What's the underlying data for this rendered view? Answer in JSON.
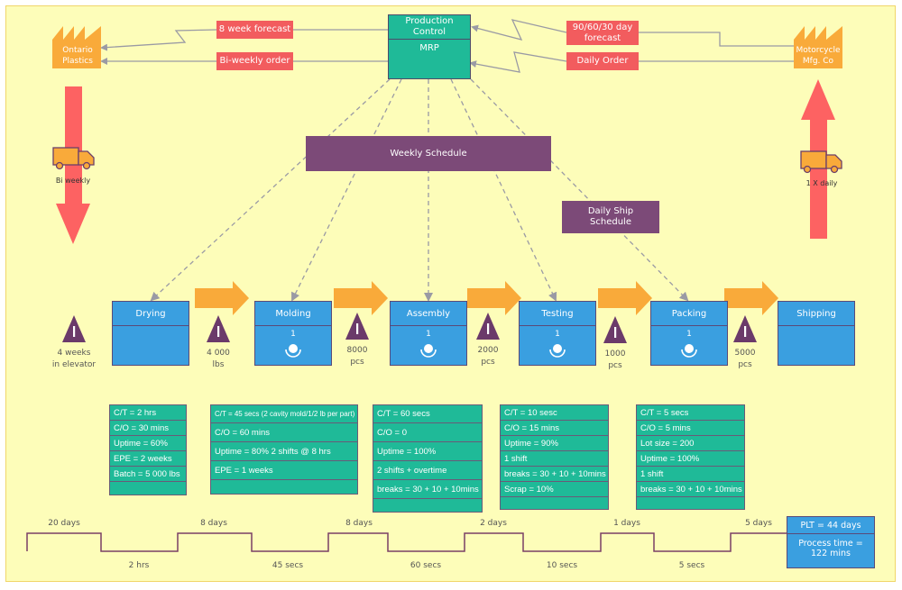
{
  "suppliers": {
    "supplier": {
      "label_line1": "Ontario",
      "label_line2": "Plastics"
    },
    "customer": {
      "label_line1": "Motorcycle",
      "label_line2": "Mfg. Co"
    }
  },
  "control": {
    "title": "Production Control",
    "subtitle": "MRP"
  },
  "info_flows": {
    "forecast_to_supplier": "8 week forecast",
    "order_to_supplier": "Bi-weekly order",
    "forecast_from_customer_line1": "90/60/30 day",
    "forecast_from_customer_line2": "forecast",
    "order_from_customer": "Daily Order"
  },
  "schedules": {
    "weekly": "Weekly Schedule",
    "daily_ship_line1": "Daily Ship",
    "daily_ship_line2": "Schedule"
  },
  "shipments": {
    "inbound": "Bi weekly",
    "outbound": "1 X daily"
  },
  "processes": [
    {
      "name": "Drying",
      "operators": ""
    },
    {
      "name": "Molding",
      "operators": "1"
    },
    {
      "name": "Assembly",
      "operators": "1"
    },
    {
      "name": "Testing",
      "operators": "1"
    },
    {
      "name": "Packing",
      "operators": "1"
    },
    {
      "name": "Shipping",
      "operators": ""
    }
  ],
  "inventories": [
    {
      "line1": "4 weeks",
      "line2": "in elevator"
    },
    {
      "line1": "4 000",
      "line2": "lbs"
    },
    {
      "line1": "8000",
      "line2": "pcs"
    },
    {
      "line1": "2000",
      "line2": "pcs"
    },
    {
      "line1": "1000",
      "line2": "pcs"
    },
    {
      "line1": "5000",
      "line2": "pcs"
    }
  ],
  "data_boxes": [
    {
      "rows": [
        "C/T = 2 hrs",
        "C/O = 30 mins",
        "Uptime = 60%",
        "EPE = 2 weeks",
        "Batch = 5 000 lbs",
        ""
      ]
    },
    {
      "rows": [
        "C/T = 45 secs (2 cavity mold/1/2 lb per part)",
        "C/O = 60 mins",
        "Uptime = 80% 2 shifts @ 8 hrs",
        "EPE = 1 weeks",
        ""
      ]
    },
    {
      "rows": [
        "C/T = 60 secs",
        "C/O = 0",
        "Uptime = 100%",
        "2 shifts + overtime",
        "breaks = 30 + 10 + 10mins",
        ""
      ]
    },
    {
      "rows": [
        "C/T = 10 sesc",
        "C/O = 15 mins",
        "Uptime = 90%",
        "1 shift",
        "breaks = 30 + 10 + 10mins",
        "Scrap = 10%",
        ""
      ]
    },
    {
      "rows": [
        "C/T = 5 secs",
        "C/O = 5 mins",
        "Lot size = 200",
        "Uptime = 100%",
        "1 shift",
        "breaks = 30 + 10 + 10mins",
        ""
      ]
    }
  ],
  "timeline": {
    "wait_times": [
      "20 days",
      "8 days",
      "8 days",
      "2 days",
      "1 days",
      "5 days"
    ],
    "process_times": [
      "2 hrs",
      "45 secs",
      "60 secs",
      "10 secs",
      "5 secs"
    ],
    "plt": "PLT = 44 days",
    "process_time_line1": "Process time =",
    "process_time_line2": "122 mins"
  },
  "colors": {
    "background": "#fdfdb9",
    "info_box": "#f25c5e",
    "schedule_box": "#7c4a78",
    "control_box": "#1fba98",
    "process_box": "#3a9fe0",
    "factory": "#f9aa3a",
    "push_arrow": "#f9aa3a",
    "shipment_arrow": "#fd6262"
  }
}
